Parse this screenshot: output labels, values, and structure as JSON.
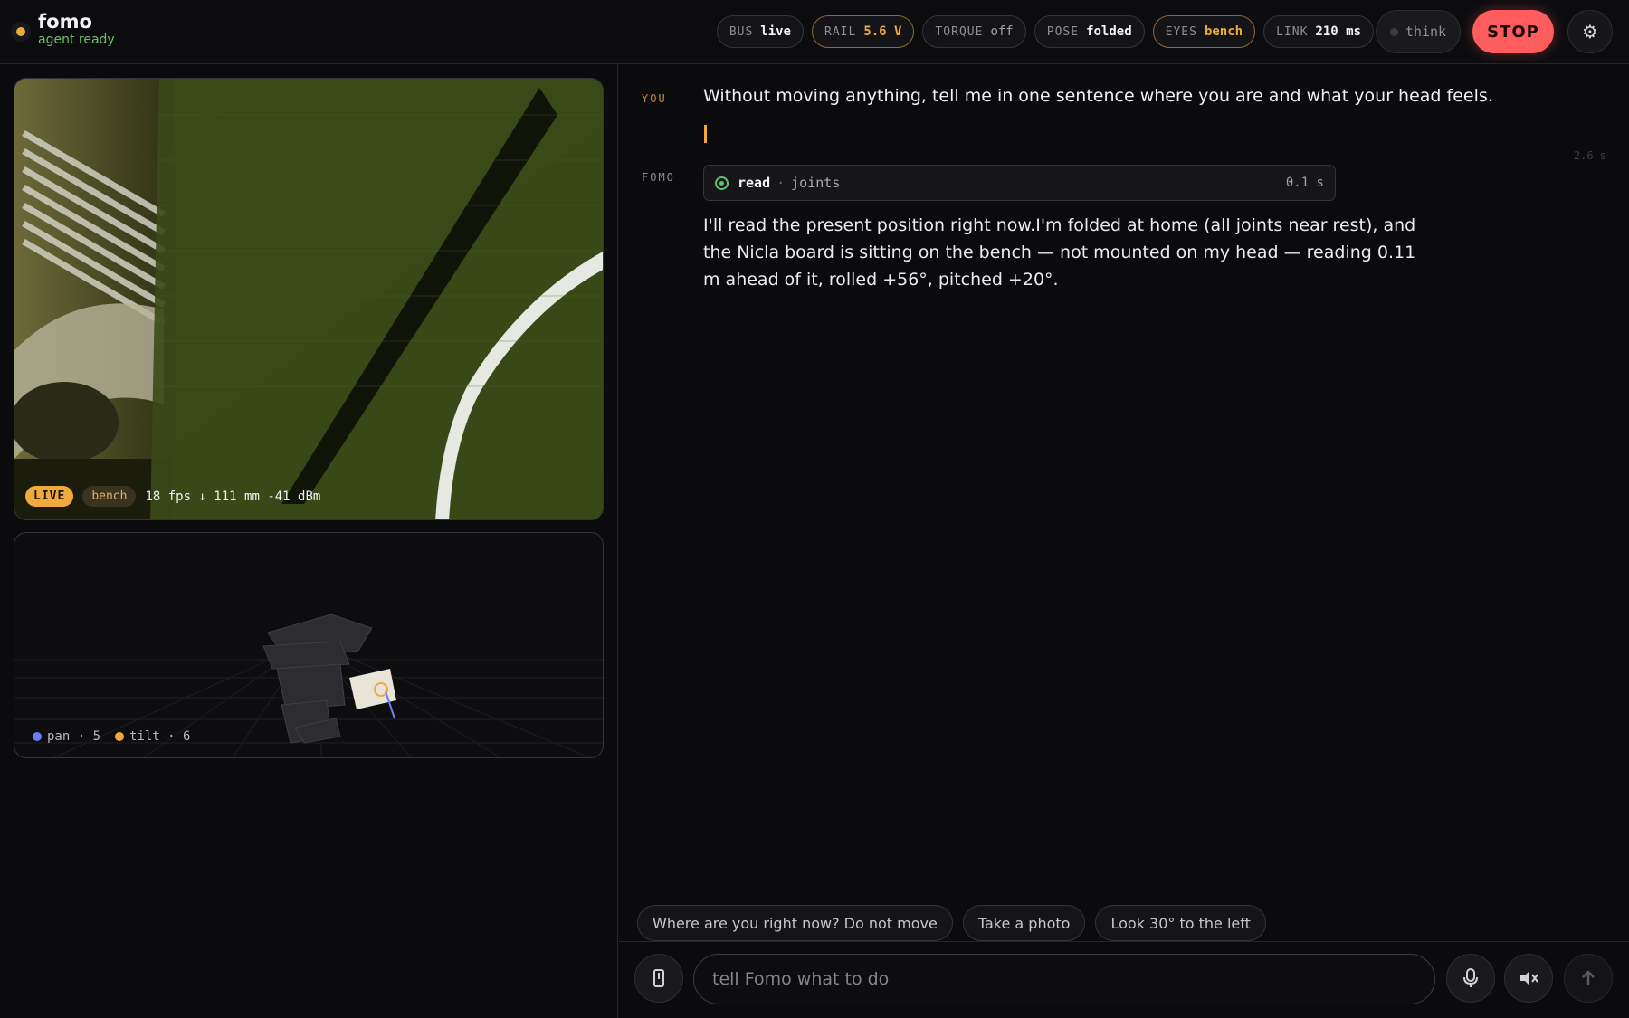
{
  "header": {
    "app_name": "fomo",
    "status": "agent ready",
    "chips": [
      {
        "key": "BUS",
        "value": "live"
      },
      {
        "key": "RAIL",
        "value": "5.6 V"
      },
      {
        "key": "TORQUE",
        "value": "off"
      },
      {
        "key": "POSE",
        "value": "folded"
      },
      {
        "key": "EYES",
        "value": "bench"
      },
      {
        "key": "LINK",
        "value": "210 ms"
      }
    ],
    "think_label": "think",
    "stop_label": "STOP",
    "settings_icon": "gear-icon"
  },
  "camera": {
    "live_badge": "LIVE",
    "source_badge": "bench",
    "stats": "18 fps ↓ 111 mm -41 dBm"
  },
  "model_view": {
    "legend": [
      {
        "label": "pan · 5",
        "color": "#6d7cf5"
      },
      {
        "label": "tilt · 6",
        "color": "#f0a93c"
      }
    ]
  },
  "chat": {
    "you_label": "YOU",
    "you_text": "Without moving anything, tell me in one sentence where you are and what your head feels.",
    "elapsed": "2.6 s",
    "fomo_label": "FOMO",
    "tool": {
      "name": "read",
      "arg": "joints",
      "time": "0.1 s"
    },
    "fomo_text": "I'll read the present position right now.I'm folded at home (all joints near rest), and the Nicla board is sitting on the bench — not mounted on my head — reading 0.11 m ahead of it, rolled +56°, pitched +20°."
  },
  "suggestions": [
    "Where are you right now? Do not move",
    "Take a photo",
    "Look 30° to the left"
  ],
  "composer": {
    "placeholder": "tell Fomo what to do",
    "icons": [
      "attach-icon",
      "microphone-icon",
      "speaker-muted-icon",
      "send-arrow-icon"
    ]
  },
  "colors": {
    "accent": "#f0a93c",
    "stop": "#ff5d5d",
    "ok": "#5cc46a"
  }
}
